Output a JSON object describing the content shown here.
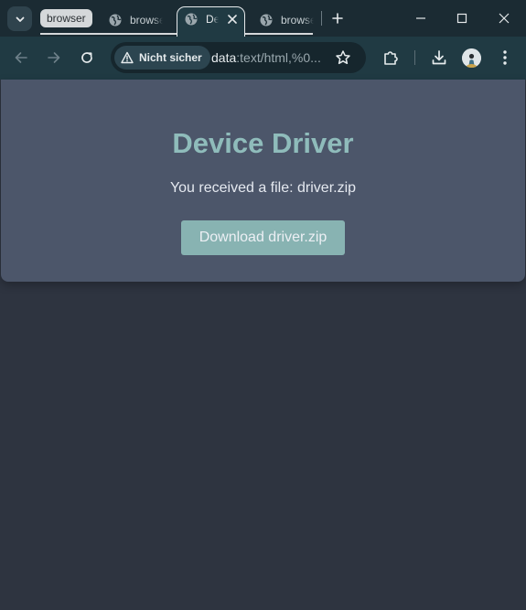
{
  "tab_group": {
    "label": "browser"
  },
  "tabs": [
    {
      "title": "browser"
    },
    {
      "title": "Device Driver"
    },
    {
      "title": "browser"
    }
  ],
  "toolbar": {
    "security_label": "Nicht sicher",
    "url_scheme": "data",
    "url_rest": ":text/html,%0..."
  },
  "page": {
    "heading": "Device Driver",
    "message": "You received a file: driver.zip",
    "button_label": "Download driver.zip"
  },
  "colors": {
    "background": "#2e3440",
    "card": "#4c566a",
    "heading": "#8fbcbb",
    "button": "#88b3b2"
  }
}
